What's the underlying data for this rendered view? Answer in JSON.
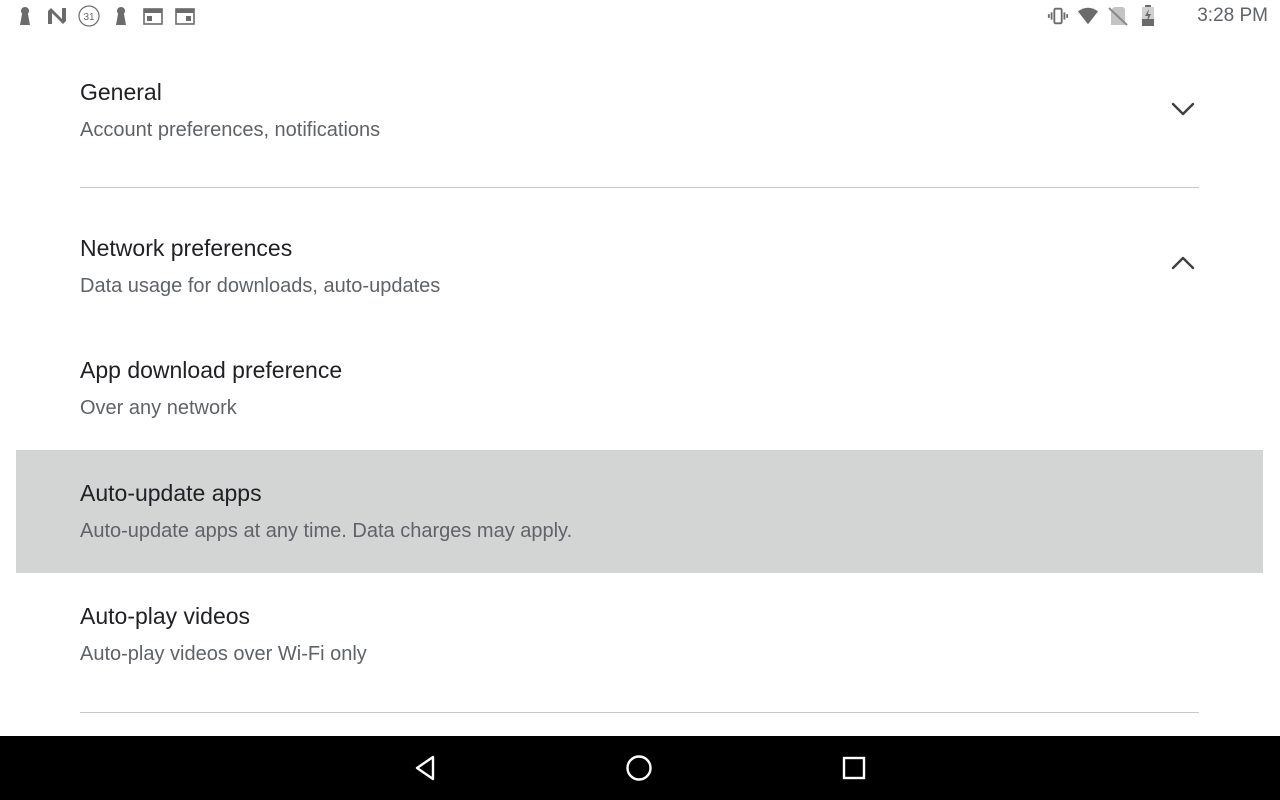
{
  "status_bar": {
    "time": "3:28 PM",
    "left_icons": [
      "keyhole-icon",
      "n-logo-icon",
      "calendar-31-icon",
      "keyhole-icon",
      "calendar-icon",
      "calendar-icon"
    ],
    "calendar_day": "31",
    "right_icons": [
      "vibrate-icon",
      "wifi-icon",
      "no-sim-icon",
      "battery-icon"
    ]
  },
  "sections": {
    "general": {
      "title": "General",
      "subtitle": "Account preferences, notifications",
      "expanded": false
    },
    "network": {
      "title": "Network preferences",
      "subtitle": "Data usage for downloads, auto-updates",
      "expanded": true
    }
  },
  "network_items": [
    {
      "title": "App download preference",
      "subtitle": "Over any network",
      "selected": false
    },
    {
      "title": "Auto-update apps",
      "subtitle": "Auto-update apps at any time. Data charges may apply.",
      "selected": true
    },
    {
      "title": "Auto-play videos",
      "subtitle": "Auto-play videos over Wi-Fi only",
      "selected": false
    }
  ],
  "nav_bar": {
    "icons": [
      "back-icon",
      "home-icon",
      "recents-icon"
    ]
  },
  "colors": {
    "title": "#202124",
    "subtitle": "#5f6368",
    "highlight": "#d3d4d4",
    "divider": "#c8c8c8",
    "nav_background": "#000000"
  }
}
